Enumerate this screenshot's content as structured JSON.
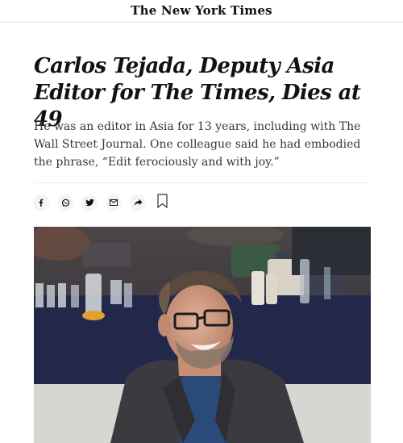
{
  "masthead": {
    "logo_text": "The New York Times"
  },
  "article": {
    "headline": "Carlos Tejada, Deputy Asia Editor for The Times, Dies at 49",
    "summary": "He was an editor in Asia for 13 years, including with The Wall Street Journal. One colleague said he had embodied the phrase, “Edit ferociously and with joy.”"
  },
  "share_bar": {
    "icons": [
      "facebook-icon",
      "whatsapp-icon",
      "twitter-icon",
      "email-icon",
      "share-arrow-icon",
      "bookmark-icon"
    ]
  },
  "colors": {
    "text": "#121212",
    "summary_text": "#363636",
    "share_button_bg": "#f4f4f4",
    "rule": "#ebebeb"
  }
}
